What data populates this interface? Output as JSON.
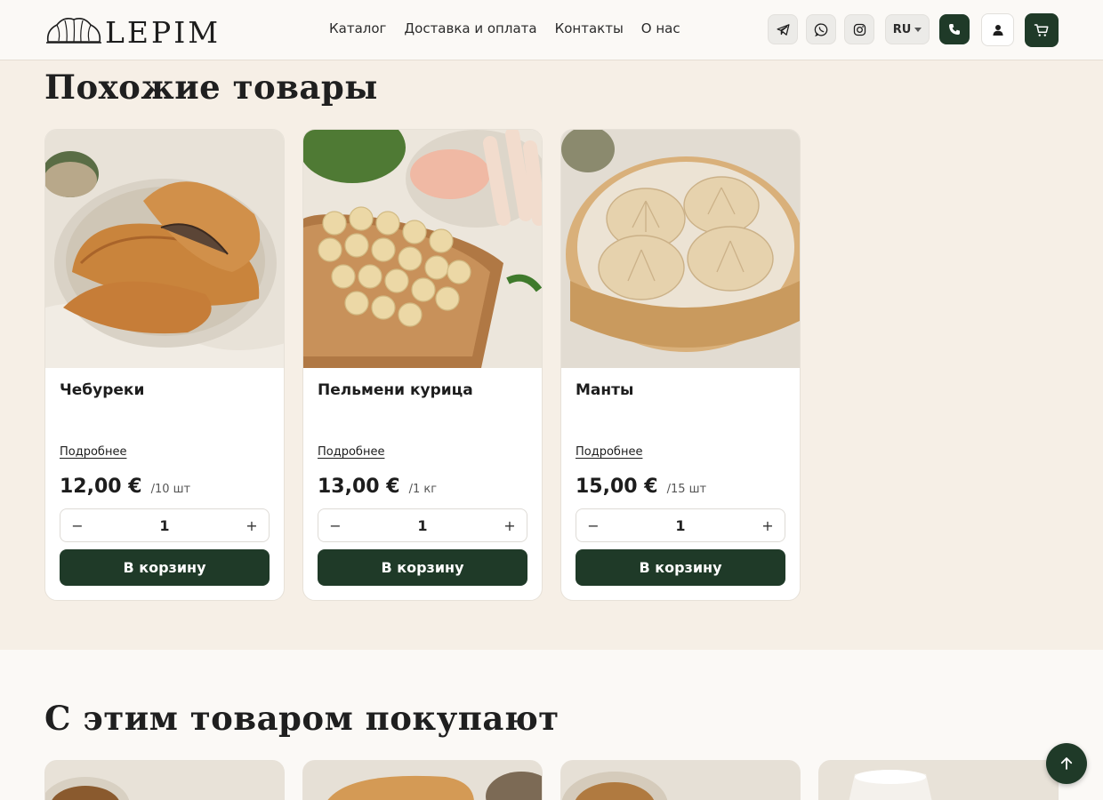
{
  "header": {
    "logo_text": "LEPIM",
    "nav": [
      "Каталог",
      "Доставка и оплата",
      "Контакты",
      "О нас"
    ],
    "lang": "RU",
    "icons": [
      "telegram-icon",
      "whatsapp-icon",
      "instagram-icon",
      "phone-icon",
      "user-icon",
      "cart-icon"
    ]
  },
  "similar": {
    "title": "Похожие товары",
    "products": [
      {
        "name": "Чебуреки",
        "more": "Подробнее",
        "price": "12,00 €",
        "unit": "/10 шт",
        "qty": "1",
        "button": "В корзину"
      },
      {
        "name": "Пельмени курица",
        "more": "Подробнее",
        "price": "13,00 €",
        "unit": "/1 кг",
        "qty": "1",
        "button": "В корзину"
      },
      {
        "name": "Манты",
        "more": "Подробнее",
        "price": "15,00 €",
        "unit": "/15 шт",
        "qty": "1",
        "button": "В корзину"
      }
    ]
  },
  "bought_with": {
    "title": "С этим товаром покупают"
  },
  "qty_minus": "−",
  "qty_plus": "+",
  "colors": {
    "accent": "#1f3a28",
    "background": "#f6efe6",
    "card": "#ffffff"
  }
}
